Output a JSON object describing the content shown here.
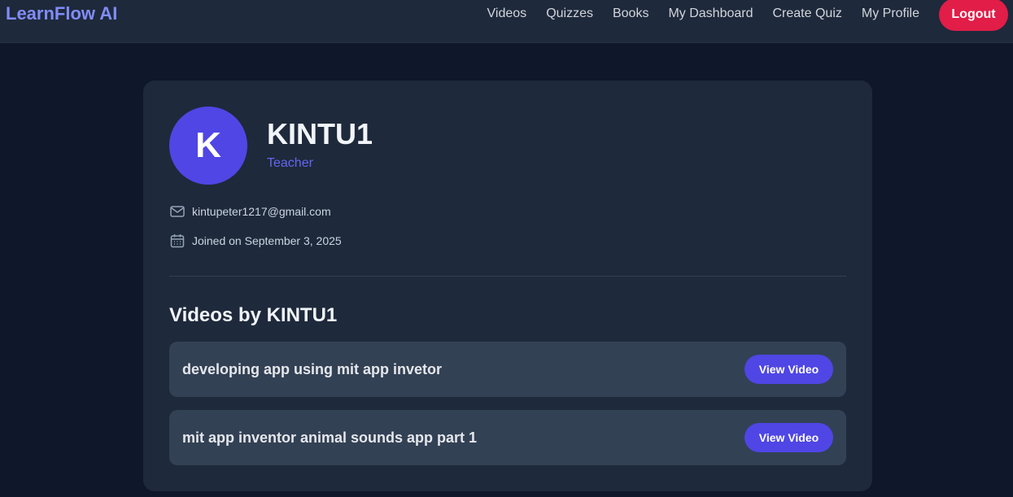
{
  "nav": {
    "brand": "LearnFlow AI",
    "links": [
      "Videos",
      "Quizzes",
      "Books",
      "My Dashboard",
      "Create Quiz",
      "My Profile"
    ],
    "logout_label": "Logout"
  },
  "profile": {
    "avatar_letter": "K",
    "username": "KINTU1",
    "role": "Teacher",
    "email": "kintupeter1217@gmail.com",
    "joined": "Joined on September 3, 2025",
    "email_icon": "mail-icon",
    "joined_icon": "calendar-icon"
  },
  "videos": {
    "section_title": "Videos by KINTU1",
    "items": [
      {
        "title": "developing app using mit app invetor",
        "button_label": "View Video"
      },
      {
        "title": "mit app inventor animal sounds app part 1",
        "button_label": "View Video"
      }
    ]
  },
  "colors": {
    "background": "#0f172a",
    "navbar": "#1e293b",
    "card": "#1e293b",
    "accent": "#4f46e5",
    "brand": "#818cf8",
    "logout": "#e11d48",
    "video_item": "#334155"
  }
}
